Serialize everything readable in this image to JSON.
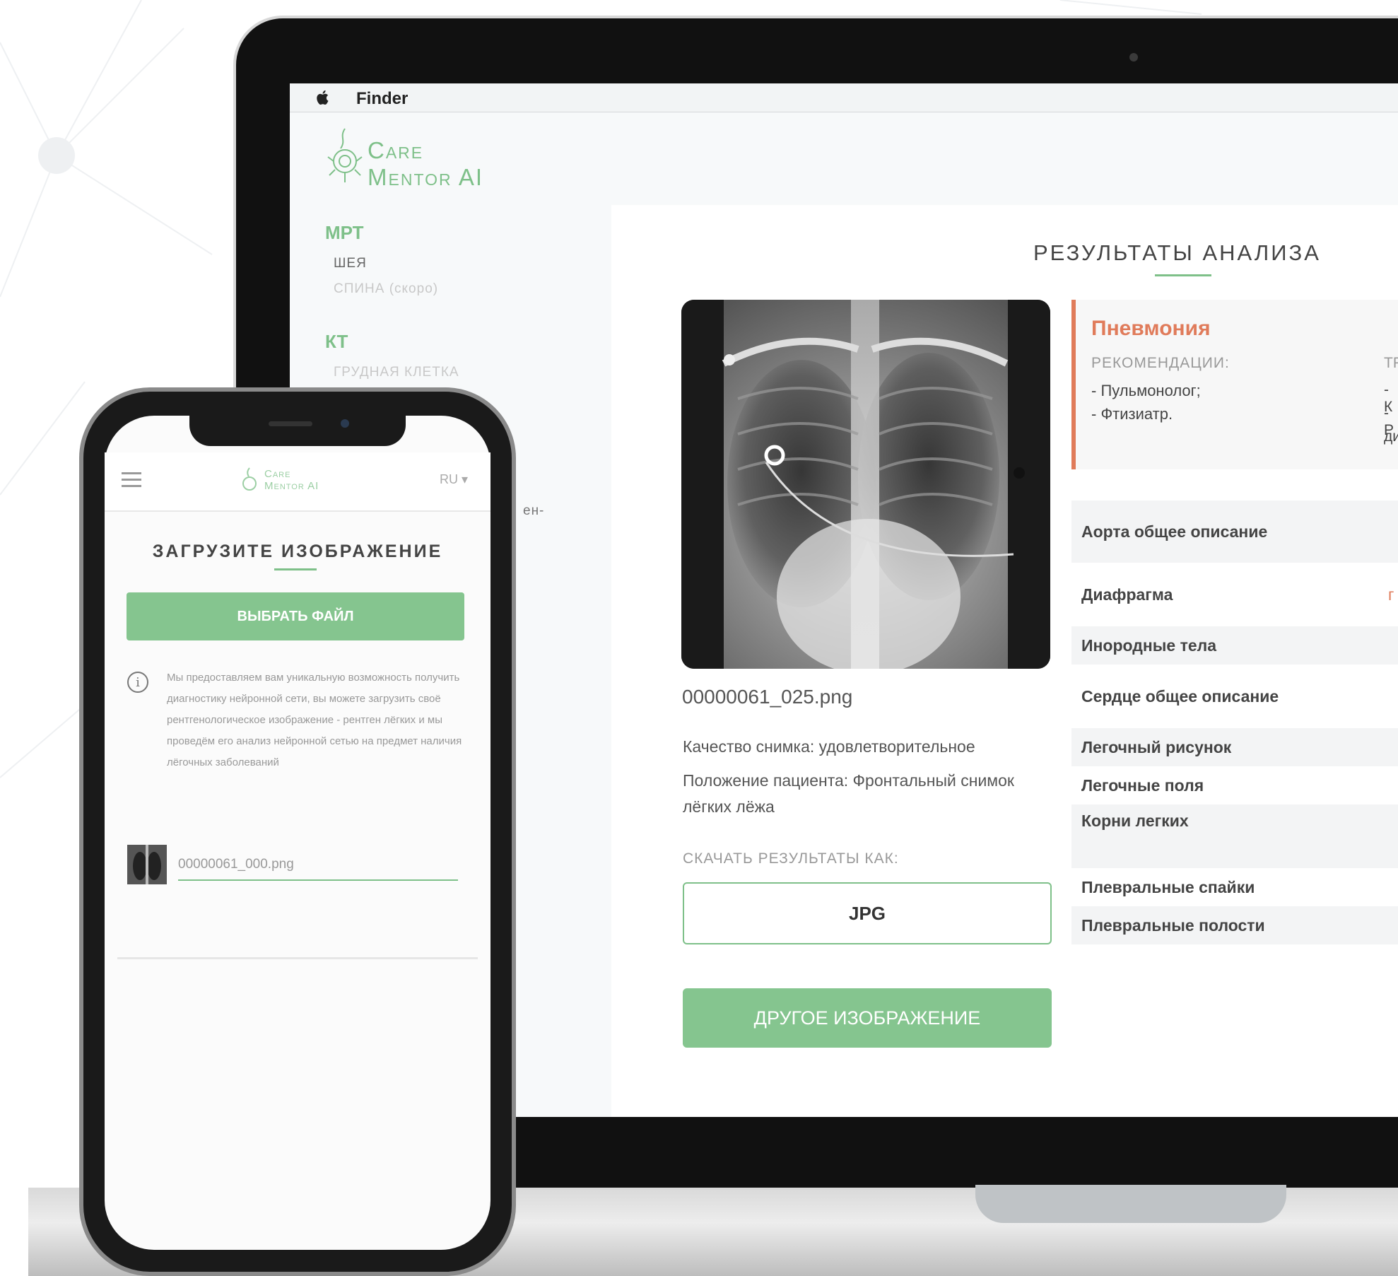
{
  "menubar": {
    "app_name": "Finder"
  },
  "brand": {
    "line1": "Care",
    "line2": "Mentor AI"
  },
  "sidebar": {
    "sections": [
      {
        "heading": "МРТ",
        "items": [
          "ШЕЯ",
          "СПИНА (скоро)"
        ]
      },
      {
        "heading": "КТ",
        "items": [
          "ГРУДНАЯ КЛЕТКА"
        ]
      }
    ],
    "partial_text": "ен-"
  },
  "results": {
    "title": "РЕЗУЛЬТАТЫ АНАЛИЗА",
    "file_name": "00000061_025.png",
    "quality": "Качество снимка: удовлетворительное",
    "position": "Положение пациента: Фронтальный снимок лёгких лёжа",
    "download_label": "СКАЧАТЬ РЕЗУЛЬТАТЫ КАК:",
    "download_format": "JPG",
    "other_image_button": "ДРУГОЕ ИЗОБРАЖЕНИЕ",
    "diagnosis": {
      "title": "Пневмония",
      "recommendations_label": "РЕКОМЕНДАЦИИ:",
      "recommendations": [
        "- Пульмонолог;",
        "- Фтизиатр."
      ],
      "cut_col_label": "ТР",
      "cut_col_lines": [
        "- К",
        "- Р",
        "ди"
      ]
    },
    "findings": [
      "Аорта общее описание",
      "Диафрагма",
      "Инородные тела",
      "Сердце общее описание",
      "Легочный рисунок",
      "Легочные поля",
      "Корни легких",
      "Плевральные спайки",
      "Плевральные полости"
    ],
    "cut_value": "г"
  },
  "phone": {
    "brand_line1": "Care",
    "brand_line2": "Mentor AI",
    "lang": "RU ▾",
    "title": "ЗАГРУЗИТЕ ИЗОБРАЖЕНИЕ",
    "choose_button": "ВЫБРАТЬ ФАЙЛ",
    "info_text": "Мы предоставляем вам уникальную возможность получить диагностику нейронной сети, вы можете загрузить своё рентгенологическое изображение - рентген лёгких и мы проведём его анализ нейронной сетью на предмет наличия лёгочных заболеваний",
    "file_name": "00000061_000.png"
  },
  "colors": {
    "accent": "#7ec089",
    "alert": "#e07b5a"
  },
  "icons": [
    "apple-icon",
    "care-mentor-logo-icon",
    "menu-icon",
    "info-icon"
  ]
}
